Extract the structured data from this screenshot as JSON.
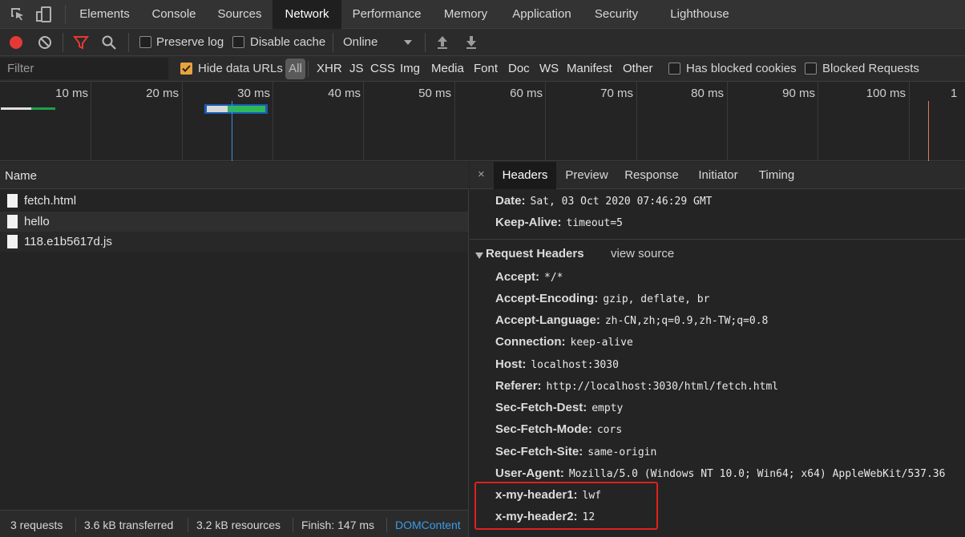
{
  "tabs": [
    {
      "label": "Elements"
    },
    {
      "label": "Console"
    },
    {
      "label": "Sources"
    },
    {
      "label": "Network"
    },
    {
      "label": "Performance"
    },
    {
      "label": "Memory"
    },
    {
      "label": "Application"
    },
    {
      "label": "Security"
    },
    {
      "label": "Lighthouse"
    }
  ],
  "active_tab": "Network",
  "toolbar": {
    "preserve_log": "Preserve log",
    "disable_cache": "Disable cache",
    "throttling": "Online"
  },
  "filter": {
    "placeholder": "Filter",
    "hide_data_urls": "Hide data URLs",
    "all": "All",
    "types": [
      "XHR",
      "JS",
      "CSS",
      "Img",
      "Media",
      "Font",
      "Doc",
      "WS",
      "Manifest",
      "Other"
    ],
    "has_blocked_cookies": "Has blocked cookies",
    "blocked_requests": "Blocked Requests"
  },
  "overview": {
    "ticks": [
      "10 ms",
      "20 ms",
      "30 ms",
      "40 ms",
      "50 ms",
      "60 ms",
      "70 ms",
      "80 ms",
      "90 ms",
      "100 ms",
      "1"
    ]
  },
  "list": {
    "header": "Name",
    "requests": [
      {
        "name": "fetch.html"
      },
      {
        "name": "hello"
      },
      {
        "name": "118.e1b5617d.js"
      }
    ]
  },
  "status": {
    "requests": "3 requests",
    "transferred": "3.6 kB transferred",
    "resources": "3.2 kB resources",
    "finish": "Finish: 147 ms",
    "domcontent": "DOMContent"
  },
  "details": {
    "close": "×",
    "tabs": [
      "Headers",
      "Preview",
      "Response",
      "Initiator",
      "Timing"
    ],
    "response_headers": [
      {
        "key": "Date:",
        "value": "Sat, 03 Oct 2020 07:46:29 GMT"
      },
      {
        "key": "Keep-Alive:",
        "value": "timeout=5"
      }
    ],
    "request_section": {
      "title": "Request Headers",
      "view_source": "view source"
    },
    "request_headers": [
      {
        "key": "Accept:",
        "value": "*/*"
      },
      {
        "key": "Accept-Encoding:",
        "value": "gzip, deflate, br"
      },
      {
        "key": "Accept-Language:",
        "value": "zh-CN,zh;q=0.9,zh-TW;q=0.8"
      },
      {
        "key": "Connection:",
        "value": "keep-alive"
      },
      {
        "key": "Host:",
        "value": "localhost:3030"
      },
      {
        "key": "Referer:",
        "value": "http://localhost:3030/html/fetch.html"
      },
      {
        "key": "Sec-Fetch-Dest:",
        "value": "empty"
      },
      {
        "key": "Sec-Fetch-Mode:",
        "value": "cors"
      },
      {
        "key": "Sec-Fetch-Site:",
        "value": "same-origin"
      },
      {
        "key": "User-Agent:",
        "value": "Mozilla/5.0 (Windows NT 10.0; Win64; x64) AppleWebKit/537.36"
      },
      {
        "key": "x-my-header1:",
        "value": "lwf"
      },
      {
        "key": "x-my-header2:",
        "value": "12"
      }
    ]
  },
  "colors": {
    "accent_blue": "#1a73e8",
    "record_red": "#e53935",
    "highlight_red": "#e02020",
    "checkbox_orange": "#e8a33d"
  }
}
